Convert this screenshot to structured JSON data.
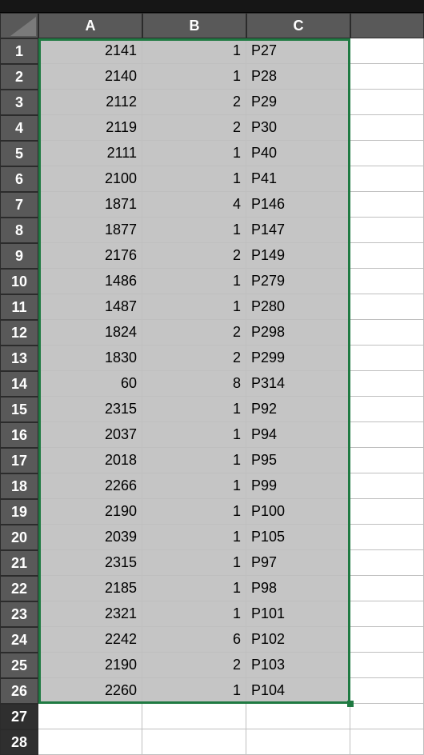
{
  "columns": [
    "A",
    "B",
    "C"
  ],
  "extra_blank_rows": [
    27,
    28
  ],
  "selection": {
    "rows": [
      1,
      26
    ],
    "cols": [
      "A",
      "C"
    ]
  },
  "rows": [
    {
      "n": 1,
      "A": 2141,
      "B": 1,
      "C": "P27"
    },
    {
      "n": 2,
      "A": 2140,
      "B": 1,
      "C": "P28"
    },
    {
      "n": 3,
      "A": 2112,
      "B": 2,
      "C": "P29"
    },
    {
      "n": 4,
      "A": 2119,
      "B": 2,
      "C": "P30"
    },
    {
      "n": 5,
      "A": 2111,
      "B": 1,
      "C": "P40"
    },
    {
      "n": 6,
      "A": 2100,
      "B": 1,
      "C": "P41"
    },
    {
      "n": 7,
      "A": 1871,
      "B": 4,
      "C": "P146"
    },
    {
      "n": 8,
      "A": 1877,
      "B": 1,
      "C": "P147"
    },
    {
      "n": 9,
      "A": 2176,
      "B": 2,
      "C": "P149"
    },
    {
      "n": 10,
      "A": 1486,
      "B": 1,
      "C": "P279"
    },
    {
      "n": 11,
      "A": 1487,
      "B": 1,
      "C": "P280"
    },
    {
      "n": 12,
      "A": 1824,
      "B": 2,
      "C": "P298"
    },
    {
      "n": 13,
      "A": 1830,
      "B": 2,
      "C": "P299"
    },
    {
      "n": 14,
      "A": 60,
      "B": 8,
      "C": "P314"
    },
    {
      "n": 15,
      "A": 2315,
      "B": 1,
      "C": "P92"
    },
    {
      "n": 16,
      "A": 2037,
      "B": 1,
      "C": "P94"
    },
    {
      "n": 17,
      "A": 2018,
      "B": 1,
      "C": "P95"
    },
    {
      "n": 18,
      "A": 2266,
      "B": 1,
      "C": "P99"
    },
    {
      "n": 19,
      "A": 2190,
      "B": 1,
      "C": "P100"
    },
    {
      "n": 20,
      "A": 2039,
      "B": 1,
      "C": "P105"
    },
    {
      "n": 21,
      "A": 2315,
      "B": 1,
      "C": "P97"
    },
    {
      "n": 22,
      "A": 2185,
      "B": 1,
      "C": "P98"
    },
    {
      "n": 23,
      "A": 2321,
      "B": 1,
      "C": "P101"
    },
    {
      "n": 24,
      "A": 2242,
      "B": 6,
      "C": "P102"
    },
    {
      "n": 25,
      "A": 2190,
      "B": 2,
      "C": "P103"
    },
    {
      "n": 26,
      "A": 2260,
      "B": 1,
      "C": "P104"
    }
  ]
}
